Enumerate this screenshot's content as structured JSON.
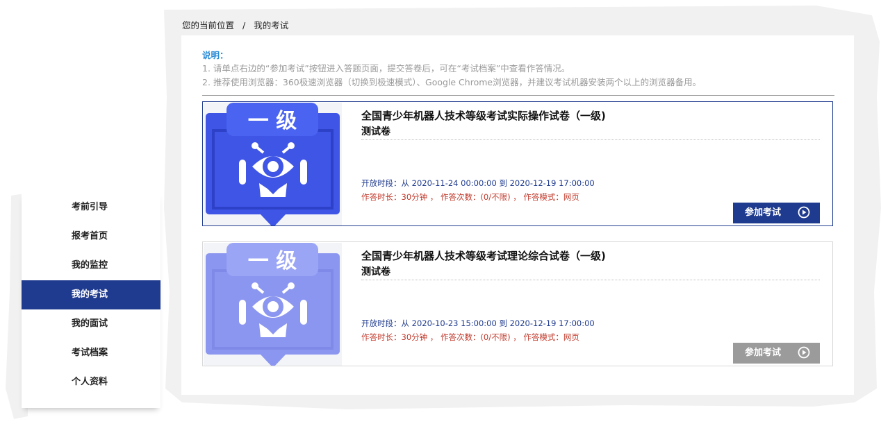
{
  "breadcrumb": {
    "prefix": "您的当前位置",
    "separator": "/",
    "current": "我的考试"
  },
  "sidebar": {
    "items": [
      {
        "label": "考前引导"
      },
      {
        "label": "报考首页"
      },
      {
        "label": "我的监控"
      },
      {
        "label": "我的考试",
        "active": true
      },
      {
        "label": "我的面试"
      },
      {
        "label": "考试档案"
      },
      {
        "label": "个人资料"
      }
    ]
  },
  "notes": {
    "title": "说明：",
    "lines": [
      "1. 请单点右边的“参加考试”按钮进入答题页面，提交答卷后，可在“考试档案”中查看作答情况。",
      "2. 推荐使用浏览器：360极速浏览器（切换到极速模式）、Google Chrome浏览器，并建议考试机器安装两个以上的浏览器备用。"
    ]
  },
  "exams": [
    {
      "badge": "一 级",
      "title": "全国青少年机器人技术等级考试实际操作试卷（一级)",
      "subtitle": "测试卷",
      "period": "开放时段：从 2020-11-24 00:00:00 到 2020-12-19 17:00:00",
      "limits": "作答时长：30分钟 ， 作答次数：(0/不限) ， 作答模式：网页",
      "button": "参加考试",
      "enabled": true,
      "colors": {
        "primary": "#3f55e6",
        "dark": "#2d40c8",
        "tab": "#4a63f0"
      }
    },
    {
      "badge": "一 级",
      "title": "全国青少年机器人技术等级考试理论综合试卷（一级)",
      "subtitle": "测试卷",
      "period": "开放时段：从 2020-10-23 15:00:00 到 2020-12-19 17:00:00",
      "limits": "作答时长：30分钟 ， 作答次数：(0/不限) ， 作答模式：网页",
      "button": "参加考试",
      "enabled": false,
      "colors": {
        "primary": "#8b96f0",
        "dark": "#7f8ae8",
        "tab": "#9aa5f5"
      }
    }
  ],
  "icons": {
    "robot": "robot-eye-icon",
    "play": "play-circle-icon"
  }
}
